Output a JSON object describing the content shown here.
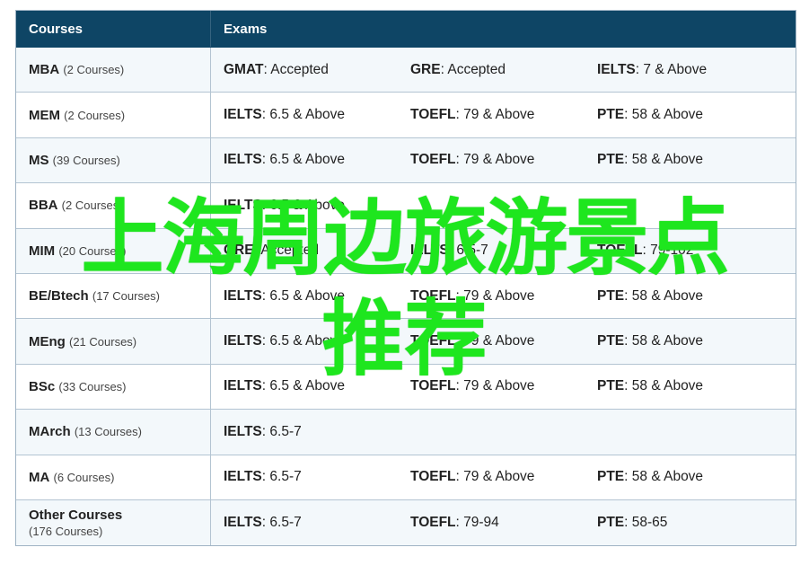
{
  "header": {
    "courses": "Courses",
    "exams": "Exams"
  },
  "rows": [
    {
      "course": "MBA",
      "count": "(2 Courses)",
      "exams": [
        {
          "name": "GMAT",
          "value": ": Accepted"
        },
        {
          "name": "GRE",
          "value": ": Accepted"
        },
        {
          "name": "IELTS",
          "value": ": 7 & Above"
        }
      ]
    },
    {
      "course": "MEM",
      "count": "(2 Courses)",
      "exams": [
        {
          "name": "IELTS",
          "value": ": 6.5 & Above"
        },
        {
          "name": "TOEFL",
          "value": ": 79 & Above"
        },
        {
          "name": "PTE",
          "value": ": 58 & Above"
        }
      ]
    },
    {
      "course": "MS",
      "count": "(39 Courses)",
      "exams": [
        {
          "name": "IELTS",
          "value": ": 6.5 & Above"
        },
        {
          "name": "TOEFL",
          "value": ": 79 & Above"
        },
        {
          "name": "PTE",
          "value": ": 58 & Above"
        }
      ]
    },
    {
      "course": "BBA",
      "count": "(2 Courses)",
      "exams": [
        {
          "name": "IELTS",
          "value": ": 6.5 & Above"
        },
        {
          "name": "",
          "value": ""
        },
        {
          "name": "",
          "value": ""
        }
      ]
    },
    {
      "course": "MIM",
      "count": "(20 Courses)",
      "exams": [
        {
          "name": "GRE",
          "value": ": Accepted"
        },
        {
          "name": "IELTS",
          "value": ": 6.5-7"
        },
        {
          "name": "TOEFL",
          "value": ": 79-102"
        }
      ]
    },
    {
      "course": "BE/Btech",
      "count": "(17 Courses)",
      "exams": [
        {
          "name": "IELTS",
          "value": ": 6.5 & Above"
        },
        {
          "name": "TOEFL",
          "value": ": 79 & Above"
        },
        {
          "name": "PTE",
          "value": ": 58 & Above"
        }
      ]
    },
    {
      "course": "MEng",
      "count": "(21 Courses)",
      "exams": [
        {
          "name": "IELTS",
          "value": ": 6.5 & Above"
        },
        {
          "name": "TOEFL",
          "value": ": 79 & Above"
        },
        {
          "name": "PTE",
          "value": ": 58 & Above"
        }
      ]
    },
    {
      "course": "BSc",
      "count": "(33 Courses)",
      "exams": [
        {
          "name": "IELTS",
          "value": ": 6.5 & Above"
        },
        {
          "name": "TOEFL",
          "value": ": 79 & Above"
        },
        {
          "name": "PTE",
          "value": ": 58 & Above"
        }
      ]
    },
    {
      "course": "MArch",
      "count": "(13 Courses)",
      "exams": [
        {
          "name": "IELTS",
          "value": ": 6.5-7"
        },
        {
          "name": "",
          "value": ""
        },
        {
          "name": "",
          "value": ""
        }
      ]
    },
    {
      "course": "MA",
      "count": "(6 Courses)",
      "exams": [
        {
          "name": "IELTS",
          "value": ": 6.5-7"
        },
        {
          "name": "TOEFL",
          "value": ": 79 & Above"
        },
        {
          "name": "PTE",
          "value": ": 58 & Above"
        }
      ]
    },
    {
      "course": "Other Courses",
      "count": "(176 Courses)",
      "exams": [
        {
          "name": "IELTS",
          "value": ": 6.5-7"
        },
        {
          "name": "TOEFL",
          "value": ": 79-94"
        },
        {
          "name": "PTE",
          "value": ": 58-65"
        }
      ]
    }
  ],
  "watermark": {
    "line1": "上海周边旅游景点",
    "line2": "推荐",
    "color": "#1ee61e"
  },
  "colors": {
    "header_bg": "#0e4565",
    "alt_row_bg": "#f3f8fb",
    "border": "#b3c4d2"
  }
}
